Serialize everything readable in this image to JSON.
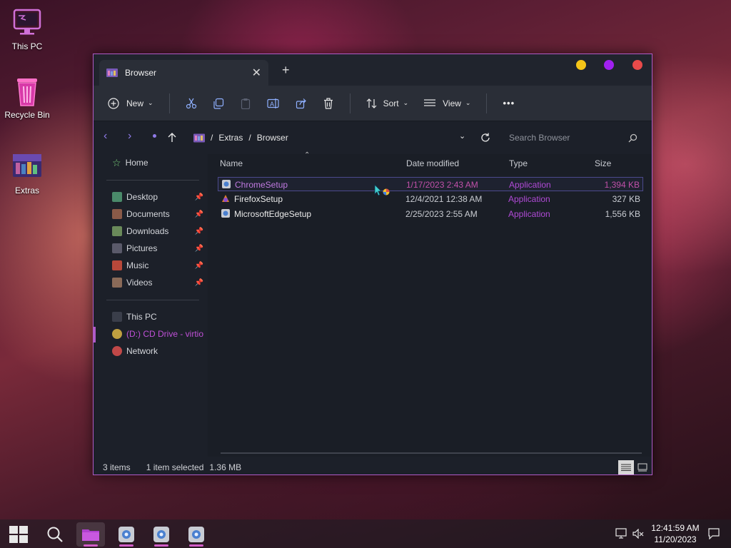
{
  "desktop": {
    "icons": [
      {
        "label": "This PC"
      },
      {
        "label": "Recycle Bin"
      },
      {
        "label": "Extras"
      }
    ]
  },
  "window": {
    "tab_title": "Browser",
    "toolbar": {
      "new_label": "New",
      "sort_label": "Sort",
      "view_label": "View",
      "more_label": "•••"
    },
    "address": {
      "path": [
        "Extras",
        "Browser"
      ],
      "separator": "/",
      "search_placeholder": "Search Browser"
    },
    "nav": {
      "home": "Home",
      "quick_access": [
        {
          "label": "Desktop",
          "color": "#4a8a6a"
        },
        {
          "label": "Documents",
          "color": "#8a5a48"
        },
        {
          "label": "Downloads",
          "color": "#6a8a5a"
        },
        {
          "label": "Pictures",
          "color": "#5a5a6a"
        },
        {
          "label": "Music",
          "color": "#b8483a"
        },
        {
          "label": "Videos",
          "color": "#8a6a58"
        }
      ],
      "this_pc": "This PC",
      "cd_drive": "(D:) CD Drive - virtio-",
      "network": "Network"
    },
    "columns": {
      "name": "Name",
      "date": "Date modified",
      "type": "Type",
      "size": "Size"
    },
    "files": [
      {
        "name": "ChromeSetup",
        "date": "1/17/2023 2:43 AM",
        "type": "Application",
        "size": "1,394 KB",
        "selected": true
      },
      {
        "name": "FirefoxSetup",
        "date": "12/4/2021 12:38 AM",
        "type": "Application",
        "size": "327 KB",
        "selected": false
      },
      {
        "name": "MicrosoftEdgeSetup",
        "date": "2/25/2023 2:55 AM",
        "type": "Application",
        "size": "1,556 KB",
        "selected": false
      }
    ],
    "status": {
      "count": "3 items",
      "selection": "1 item selected",
      "size": "1.36 MB"
    }
  },
  "taskbar": {
    "time": "12:41:59 AM",
    "date": "11/20/2023"
  },
  "colors": {
    "accent_purple": "#b05cc8",
    "selected_text": "#c07ae0",
    "type_text": "#b04ad6",
    "dot_yellow": "#f5c518",
    "dot_purple": "#a020f0",
    "dot_red": "#e84a4a"
  }
}
